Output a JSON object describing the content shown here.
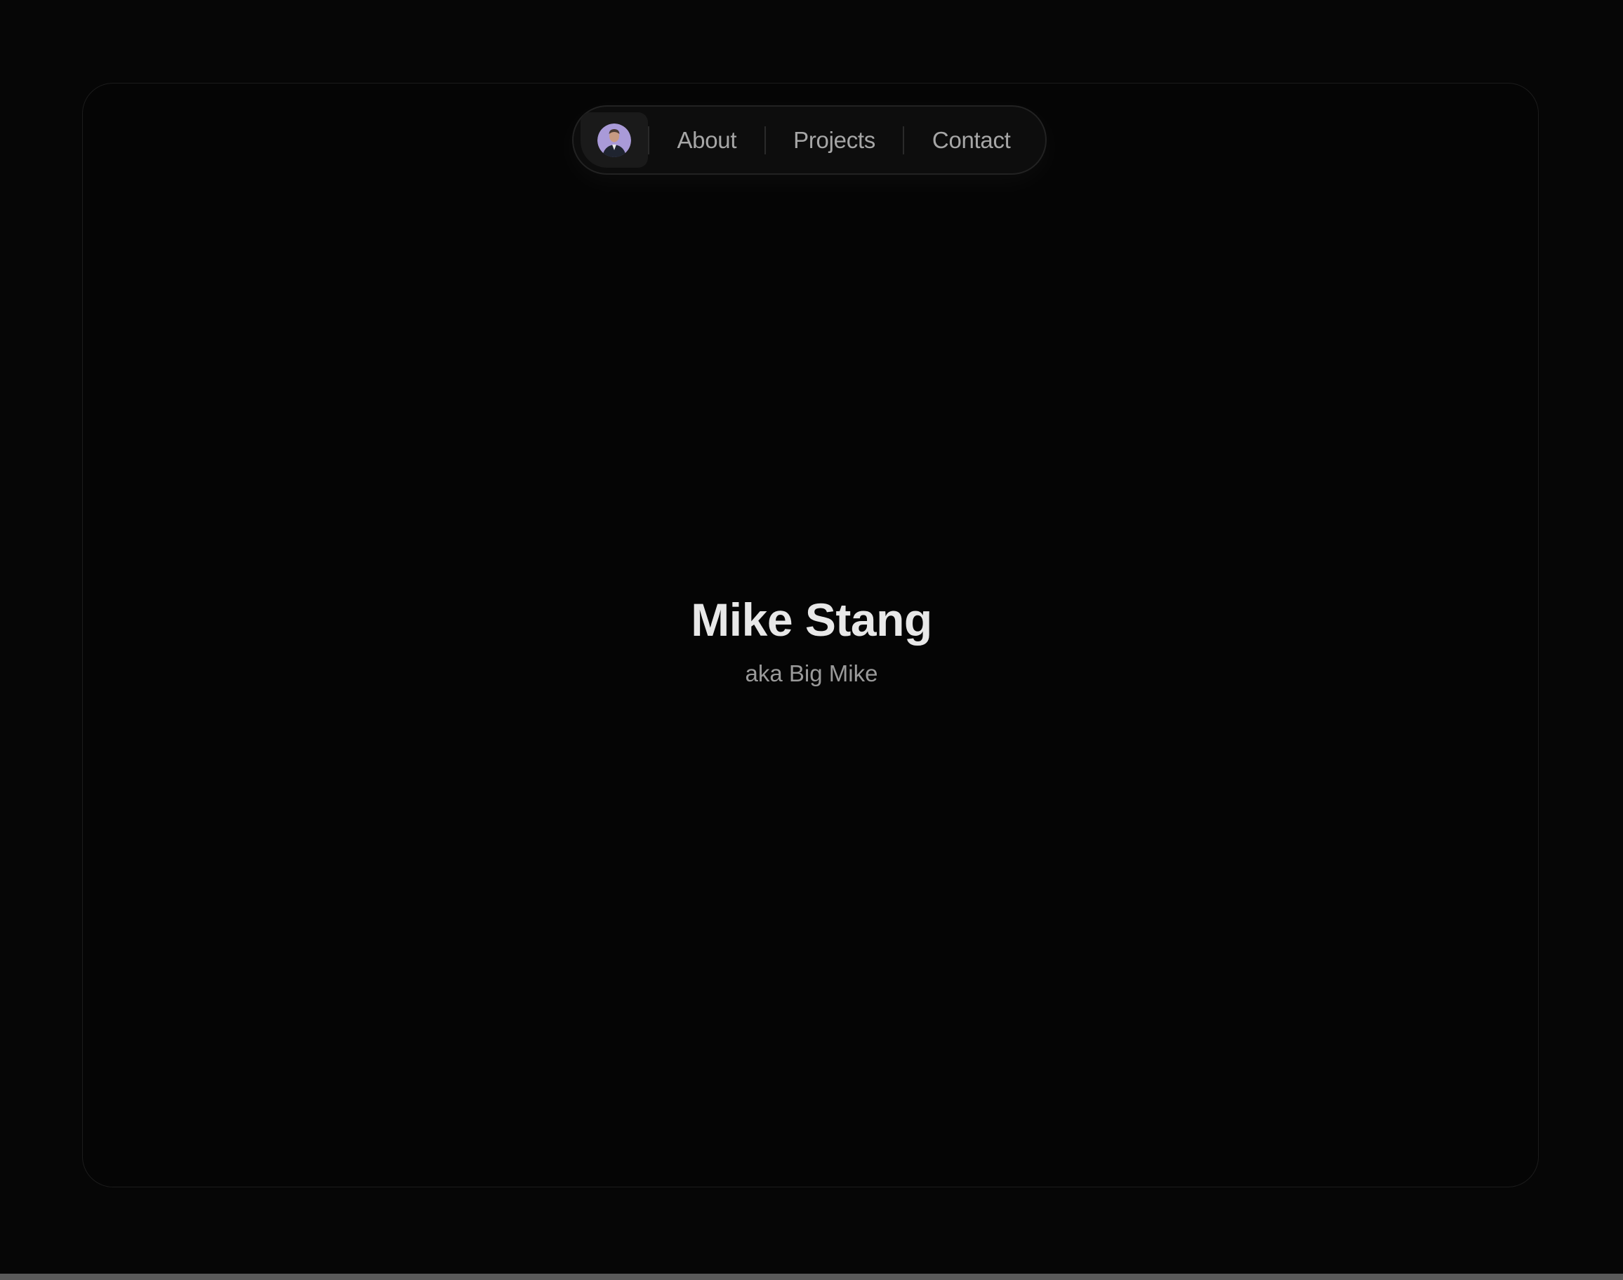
{
  "nav": {
    "avatar_alt": "Profile photo",
    "links": [
      {
        "label": "About"
      },
      {
        "label": "Projects"
      },
      {
        "label": "Contact"
      }
    ]
  },
  "hero": {
    "name": "Mike Stang",
    "alias": "aka Big Mike"
  },
  "colors": {
    "background": "#060606",
    "frame_border": "#1c1c1c",
    "nav_background": "#0d0d0d",
    "nav_text": "#a6a6a6",
    "title_text": "#e8e8e8",
    "subtitle_text": "#9a9a9a",
    "avatar_background": "#a99ad8"
  }
}
